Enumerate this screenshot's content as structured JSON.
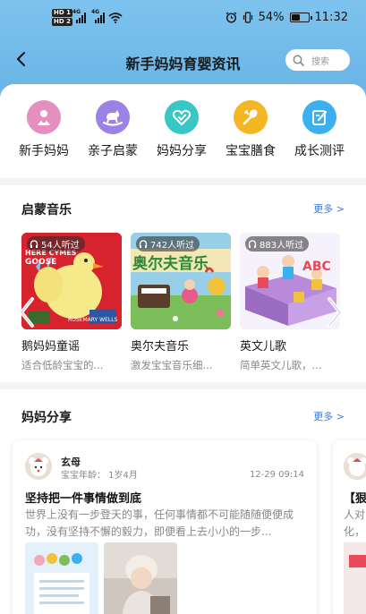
{
  "status_bar": {
    "hd1": "HD 1",
    "hd2": "HD 2",
    "net1": "4G",
    "net2": "4G",
    "battery_percent": "54%",
    "battery_level": 0.54,
    "time": "11:32"
  },
  "nav": {
    "title": "新手妈妈育婴资讯",
    "search_placeholder": "搜索"
  },
  "categories": [
    {
      "label": "新手妈妈",
      "color": "#e58fc0",
      "icon": "mom-icon"
    },
    {
      "label": "亲子启蒙",
      "color": "#9b82e6",
      "icon": "rocking-horse-icon"
    },
    {
      "label": "妈妈分享",
      "color": "#38c7c4",
      "icon": "heart-share-icon"
    },
    {
      "label": "宝宝膳食",
      "color": "#f4b724",
      "icon": "spoon-icon"
    },
    {
      "label": "成长测评",
      "color": "#3cb0ef",
      "icon": "edit-icon"
    }
  ],
  "music": {
    "title": "启蒙音乐",
    "more": "更多 >",
    "items": [
      {
        "title": "鹅妈妈童谣",
        "desc": "适合低龄宝宝的...",
        "listens": "54人听过",
        "cover_text_1": "HERE CYMES",
        "cover_text_2": "GOOSE",
        "cover_text_3": "ROSEMARY WELLS"
      },
      {
        "title": "奥尔夫音乐",
        "desc": "激发宝宝音乐细...",
        "listens": "742人听过",
        "cover_text_1": "奥尔夫音乐"
      },
      {
        "title": "英文儿歌",
        "desc": "简单英文儿歌，...",
        "listens": "883人听过",
        "cover_text_1": "ABC"
      }
    ]
  },
  "share": {
    "title": "妈妈分享",
    "more": "更多 >",
    "post": {
      "author": "玄母",
      "baby_age": "宝宝年龄：  1岁4月",
      "time": "12-29 09:14",
      "title": "坚持把一件事情做到底",
      "body": "世界上没有一步登天的事，任何事情都不可能随随便便成功，没有坚持不懈的毅力，即便看上去小小的一步..."
    },
    "next_post": {
      "title": "【狠",
      "body_line1": "人对",
      "body_line2": "化，"
    }
  }
}
